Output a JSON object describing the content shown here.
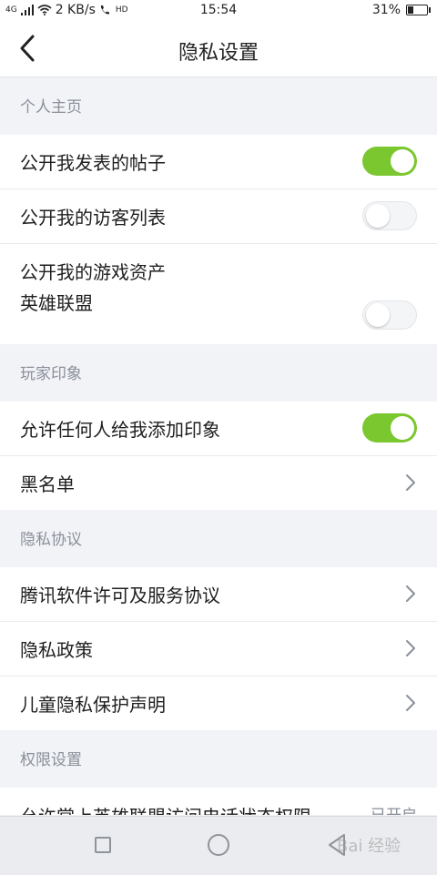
{
  "status_bar": {
    "network": "4G",
    "speed": "2 KB/s",
    "hd": "HD",
    "time": "15:54",
    "battery": "31%",
    "battery_level": 0.31
  },
  "header": {
    "title": "隐私设置"
  },
  "sections": [
    {
      "title": "个人主页",
      "items": [
        {
          "label": "公开我发表的帖子",
          "toggle": true
        },
        {
          "label": "公开我的访客列表",
          "toggle": false
        },
        {
          "label": "公开我的游戏资产",
          "sublabel": "英雄联盟",
          "toggle": false
        }
      ]
    },
    {
      "title": "玩家印象",
      "items": [
        {
          "label": "允许任何人给我添加印象",
          "toggle": true
        },
        {
          "label": "黑名单"
        }
      ]
    },
    {
      "title": "隐私协议",
      "items": [
        {
          "label": "腾讯软件许可及服务协议"
        },
        {
          "label": "隐私政策"
        },
        {
          "label": "儿童隐私保护声明"
        }
      ]
    },
    {
      "title": "权限设置",
      "items": [
        {
          "label": "允许掌上英雄联盟访问电话状态权限",
          "status": "已开启"
        }
      ]
    }
  ],
  "colors": {
    "toggle_on": "#7ac72f",
    "background": "#f1f3f7",
    "section_text": "#8a8f99"
  },
  "watermark": "Bai 经验"
}
